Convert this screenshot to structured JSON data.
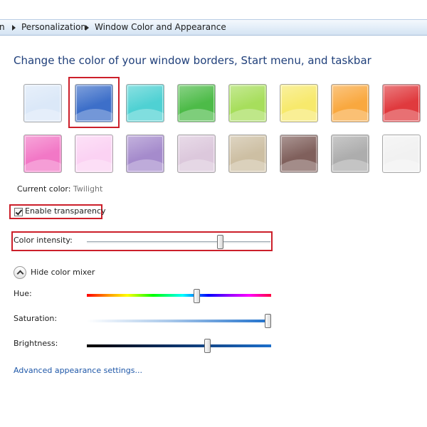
{
  "breadcrumb": {
    "items": [
      "n",
      "Personalization",
      "Window Color and Appearance"
    ],
    "separator_icon": "chevron-right-icon"
  },
  "heading": "Change the color of your window borders, Start menu, and taskbar",
  "swatches": [
    {
      "color": "#dbe8f8"
    },
    {
      "color": "#3d6fc9",
      "selected": true
    },
    {
      "color": "#4fd1d3"
    },
    {
      "color": "#4dbb48"
    },
    {
      "color": "#a7de5c"
    },
    {
      "color": "#f7e96c"
    },
    {
      "color": "#f9a83f"
    },
    {
      "color": "#e03a3e"
    },
    {
      "color": "#f278c6"
    },
    {
      "color": "#fbd2f3"
    },
    {
      "color": "#a58bcc"
    },
    {
      "color": "#dcc8dc"
    },
    {
      "color": "#cdbfa3"
    },
    {
      "color": "#80605c"
    },
    {
      "color": "#adadad"
    },
    {
      "color": "#f1f1f1"
    }
  ],
  "current_color": {
    "label": "Current color:",
    "value": "Twilight"
  },
  "transparency": {
    "label": "Enable transparency",
    "checked": true
  },
  "intensity": {
    "label": "Color intensity:",
    "value": 0.73
  },
  "mixer": {
    "toggle_label": "Hide color mixer",
    "toggle_icon": "chevron-up-icon",
    "hue": {
      "label": "Hue:",
      "value": 0.6
    },
    "saturation": {
      "label": "Saturation:",
      "value": 1.0
    },
    "brightness": {
      "label": "Brightness:",
      "value": 0.66
    }
  },
  "advanced_link": "Advanced appearance settings...",
  "colors": {
    "heading": "#1f3f7a",
    "link": "#1e57a8",
    "highlight": "#cc1f2a"
  }
}
